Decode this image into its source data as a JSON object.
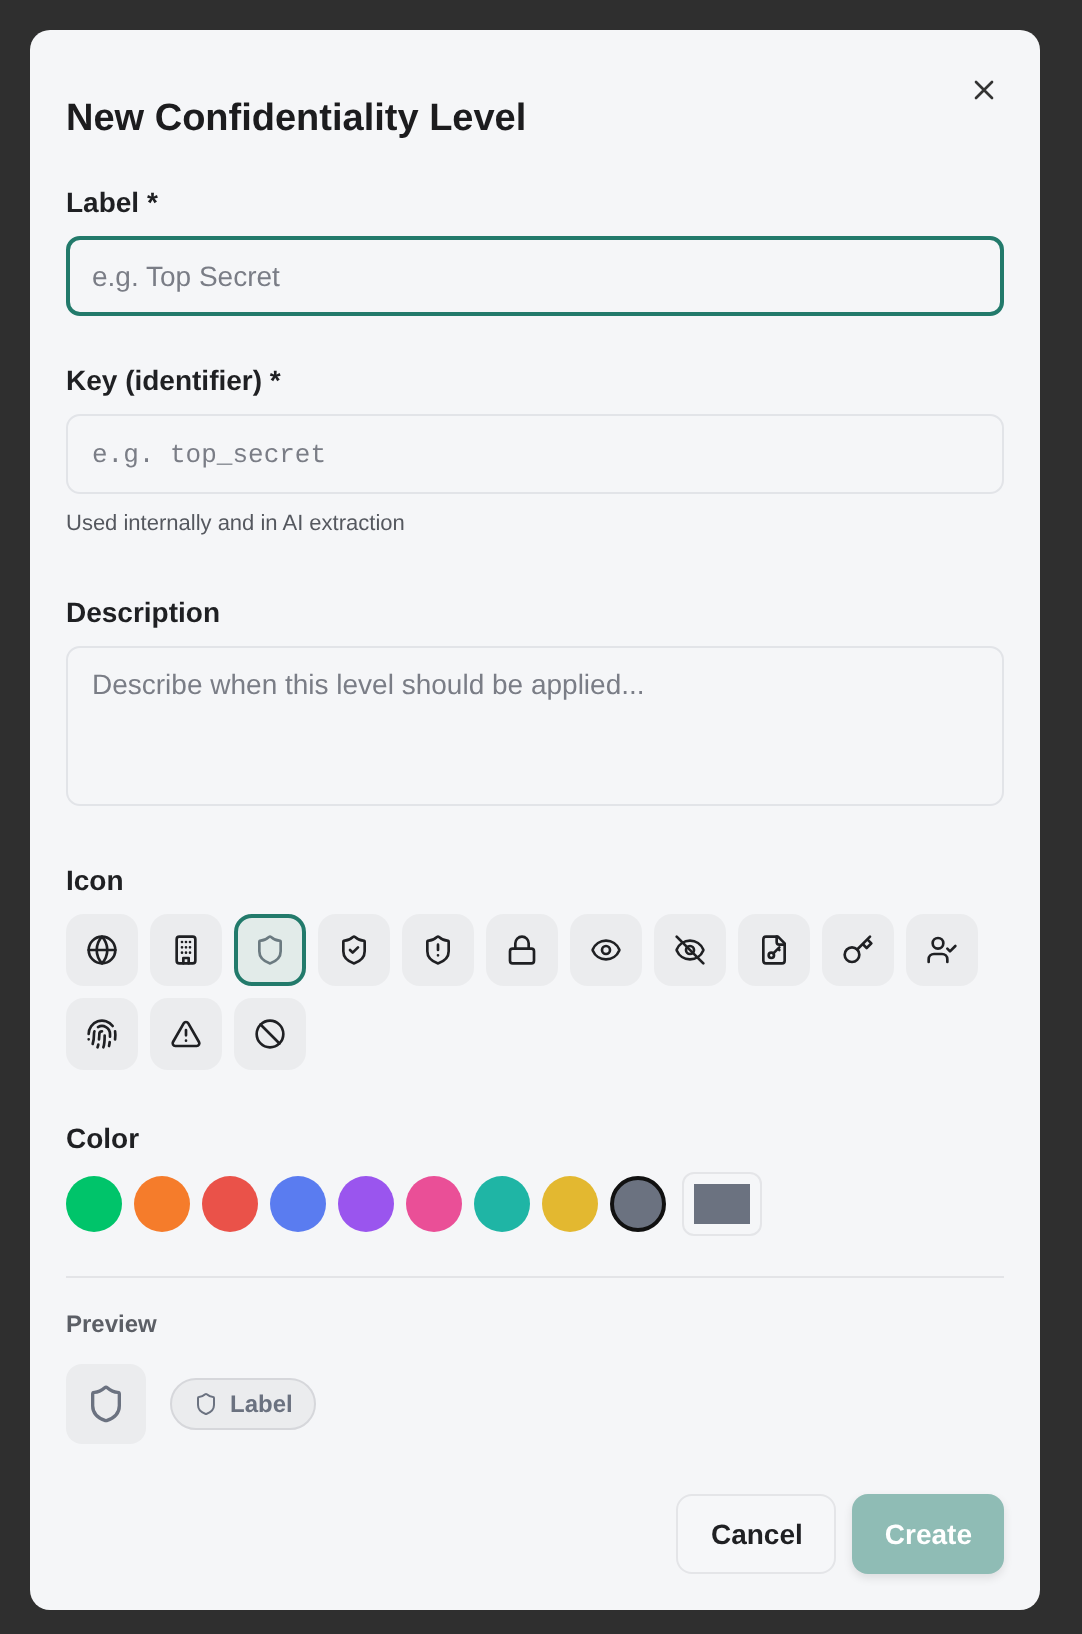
{
  "dialog": {
    "title": "New Confidentiality Level"
  },
  "fields": [
    {
      "kind": "text",
      "label": "Label *",
      "placeholder": "e.g. Top Secret",
      "focused": true
    },
    {
      "kind": "mono",
      "label": "Key (identifier) *",
      "placeholder": "e.g. top_secret",
      "focused": false,
      "hint": "Used internally and in AI extraction"
    },
    {
      "kind": "area",
      "label": "Description",
      "placeholder": "Describe when this level should be applied...",
      "focused": false
    }
  ],
  "icon_picker": {
    "label": "Icon",
    "icons": [
      {
        "kind": "globe",
        "selected": false
      },
      {
        "kind": "building",
        "selected": false
      },
      {
        "kind": "shield",
        "selected": true
      },
      {
        "kind": "shield-check",
        "selected": false
      },
      {
        "kind": "shield-alert",
        "selected": false
      },
      {
        "kind": "lock",
        "selected": false
      },
      {
        "kind": "eye",
        "selected": false
      },
      {
        "kind": "eye-off",
        "selected": false
      },
      {
        "kind": "file-key",
        "selected": false
      },
      {
        "kind": "key",
        "selected": false
      },
      {
        "kind": "user-check",
        "selected": false
      },
      {
        "kind": "fingerprint",
        "selected": false
      },
      {
        "kind": "warning",
        "selected": false
      },
      {
        "kind": "ban",
        "selected": false
      }
    ]
  },
  "color_picker": {
    "label": "Color",
    "colors": [
      {
        "color": "#00c46a",
        "selected": false
      },
      {
        "color": "#f57c2b",
        "selected": false
      },
      {
        "color": "#ea5249",
        "selected": false
      },
      {
        "color": "#5a7cf0",
        "selected": false
      },
      {
        "color": "#9a55ee",
        "selected": false
      },
      {
        "color": "#ea4f97",
        "selected": false
      },
      {
        "color": "#1fb5a5",
        "selected": false
      },
      {
        "color": "#e3b830",
        "selected": false
      },
      {
        "color": "#6b7280",
        "selected": true
      }
    ]
  },
  "preview": {
    "label": "Preview",
    "badge": "Label"
  },
  "buttons": [
    {
      "kind": "secondary",
      "label": "Cancel"
    },
    {
      "kind": "primary",
      "label": "Create",
      "disabled": true
    }
  ]
}
